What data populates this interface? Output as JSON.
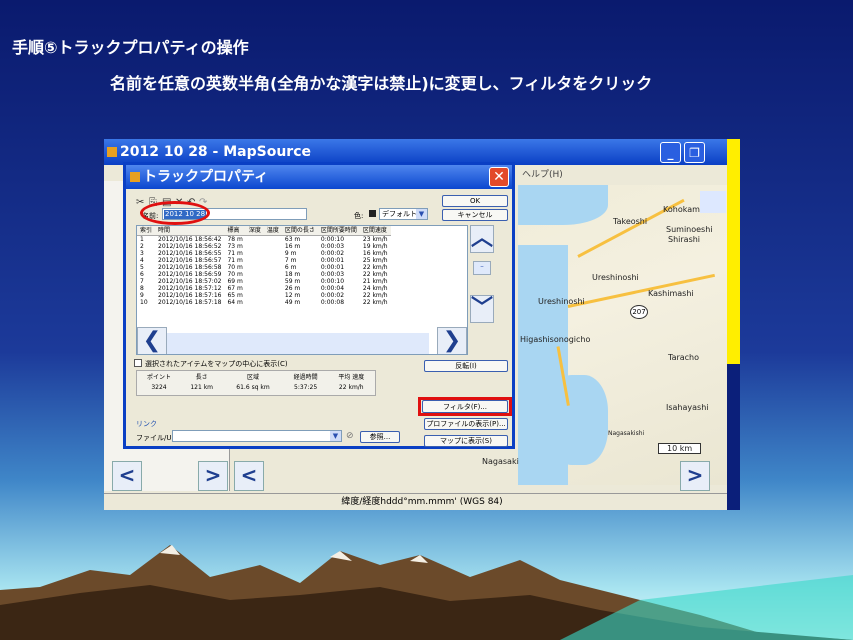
{
  "slide": {
    "title": "手順⑤トラックプロパティの操作",
    "subtitle": "名前を任意の英数半角(全角かな漢字は禁止)に変更し、フィルタをクリック"
  },
  "app": {
    "title": "2012 10 28 - MapSource",
    "menu_help": "ヘルプ(H)",
    "status": "緯度/経度hddd°mm.mmm' (WGS 84)",
    "map_labels": [
      "Kohokamachi",
      "Takeoshi",
      "Suminoeshi",
      "Shirashi",
      "Ureshinoshi",
      "Kashimashi",
      "Ureshinoshi",
      "Higashisonogicho",
      "Taracho",
      "Isahayashi",
      "Nagasakishi",
      "10 km",
      "Nagasaki"
    ],
    "route_badge": "207"
  },
  "dialog": {
    "title": "トラックプロパティ",
    "close_icon": "close-icon",
    "name_label": "名前:",
    "name_value": "2012 10 28",
    "color_label": "色:",
    "color_value": "デフォルト",
    "ok": "OK",
    "cancel": "キャンセル",
    "table": {
      "headers": [
        "索引",
        "時間",
        "標高",
        "深度",
        "温度",
        "区間の長さ",
        "区間所要時間",
        "区間速度"
      ],
      "rows": [
        [
          "1",
          "2012/10/16 18:56:42",
          "78 m",
          "",
          "",
          "63 m",
          "0:00:10",
          "23 km/h"
        ],
        [
          "2",
          "2012/10/16 18:56:52",
          "73 m",
          "",
          "",
          "16 m",
          "0:00:03",
          "19 km/h"
        ],
        [
          "3",
          "2012/10/16 18:56:55",
          "71 m",
          "",
          "",
          "9 m",
          "0:00:02",
          "16 km/h"
        ],
        [
          "4",
          "2012/10/16 18:56:57",
          "71 m",
          "",
          "",
          "7 m",
          "0:00:01",
          "25 km/h"
        ],
        [
          "5",
          "2012/10/16 18:56:58",
          "70 m",
          "",
          "",
          "6 m",
          "0:00:01",
          "22 km/h"
        ],
        [
          "6",
          "2012/10/16 18:56:59",
          "70 m",
          "",
          "",
          "18 m",
          "0:00:03",
          "22 km/h"
        ],
        [
          "7",
          "2012/10/16 18:57:02",
          "69 m",
          "",
          "",
          "59 m",
          "0:00:10",
          "21 km/h"
        ],
        [
          "8",
          "2012/10/16 18:57:12",
          "67 m",
          "",
          "",
          "26 m",
          "0:00:04",
          "24 km/h"
        ],
        [
          "9",
          "2012/10/16 18:57:16",
          "65 m",
          "",
          "",
          "12 m",
          "0:00:02",
          "22 km/h"
        ],
        [
          "10",
          "2012/10/16 18:57:18",
          "64 m",
          "",
          "",
          "49 m",
          "0:00:08",
          "22 km/h"
        ]
      ]
    },
    "checkbox_label": "選択されたアイテムをマップの中心に表示(C)",
    "invert": "反転(I)",
    "filter": "フィルタ(F)...",
    "profile": "プロファイルの表示(P)...",
    "show_on_map": "マップに表示(S)",
    "summary": {
      "headers": [
        "ポイント",
        "長さ",
        "区域",
        "経過時間",
        "平均 速度"
      ],
      "values": [
        "3224",
        "121 km",
        "61.6 sq km",
        "5:37:25",
        "22 km/h"
      ]
    },
    "link_group": "リンク",
    "file_url_label": "ファイル/URL:",
    "browse": "参照..."
  }
}
